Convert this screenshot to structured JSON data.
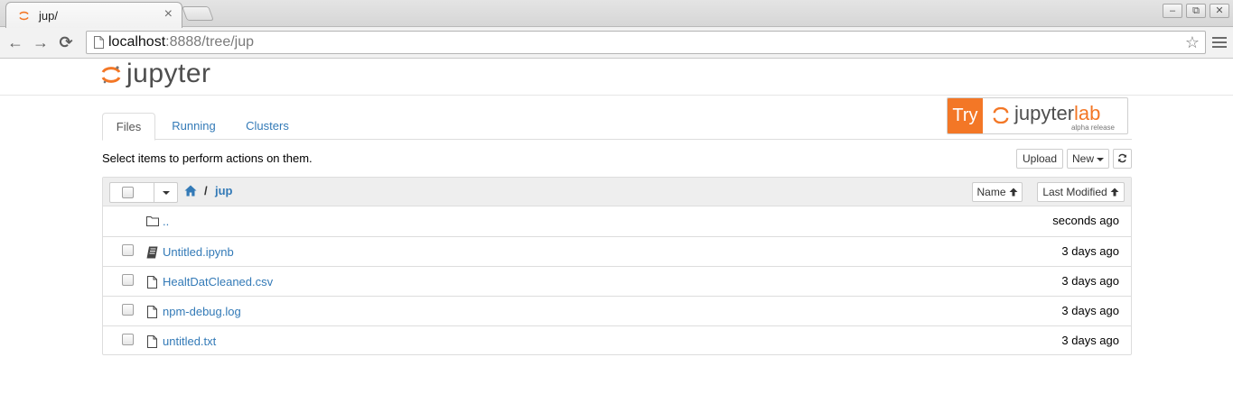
{
  "browser": {
    "tab_title": "jup/",
    "tab_close": "×",
    "url_host": "localhost",
    "url_rest": ":8888/tree/jup",
    "window_controls": [
      "–",
      "⧉",
      "✕"
    ]
  },
  "header": {
    "logo_text": "jupyter",
    "accent_color": "#f37726"
  },
  "tabs": [
    {
      "label": "Files",
      "active": true
    },
    {
      "label": "Running",
      "active": false
    },
    {
      "label": "Clusters",
      "active": false
    }
  ],
  "lab_button": {
    "try_label": "Try",
    "name_part1": "jupyter",
    "name_part2": "lab",
    "subtitle": "alpha release"
  },
  "instructions": "Select items to perform actions on them.",
  "actions": {
    "upload_label": "Upload",
    "new_label": "New",
    "refresh_icon": "refresh-icon"
  },
  "breadcrumb": {
    "separator": "/",
    "dir": "jup"
  },
  "sort": {
    "name_label": "Name",
    "modified_label": "Last Modified"
  },
  "files": [
    {
      "name": "..",
      "type": "folder",
      "modified": "seconds ago",
      "checkbox": false
    },
    {
      "name": "Untitled.ipynb",
      "type": "notebook",
      "modified": "3 days ago",
      "checkbox": true
    },
    {
      "name": "HealtDatCleaned.csv",
      "type": "file",
      "modified": "3 days ago",
      "checkbox": true
    },
    {
      "name": "npm-debug.log",
      "type": "file",
      "modified": "3 days ago",
      "checkbox": true
    },
    {
      "name": "untitled.txt",
      "type": "file",
      "modified": "3 days ago",
      "checkbox": true
    }
  ]
}
